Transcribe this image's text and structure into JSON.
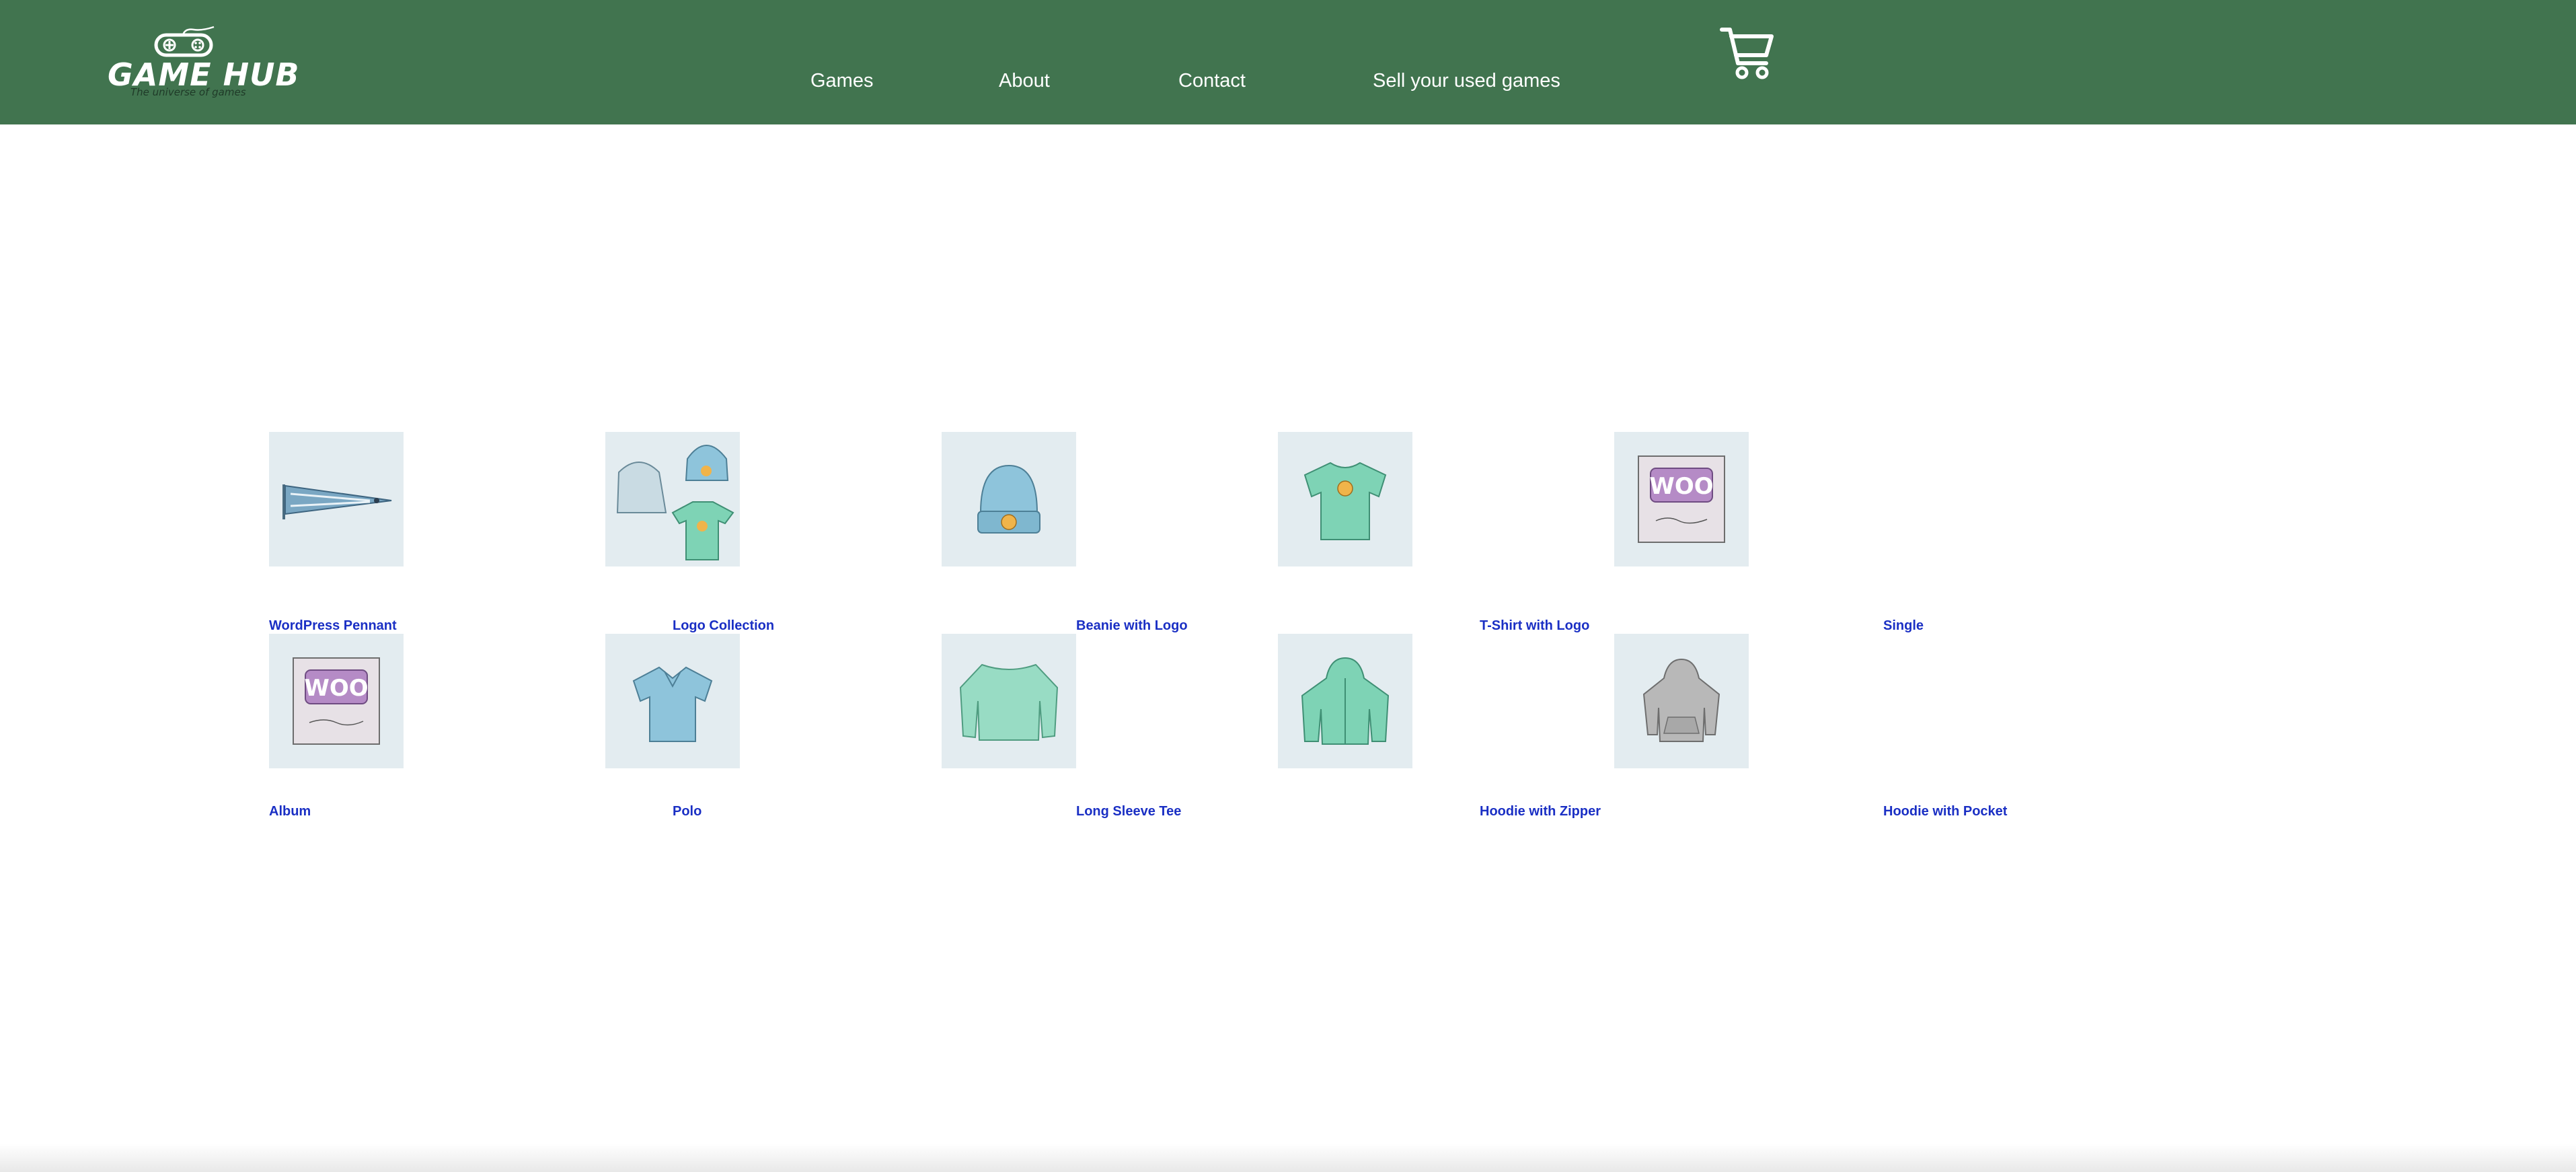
{
  "header": {
    "logo": {
      "title": "GAME HUB",
      "tagline": "The universe of games"
    },
    "nav": [
      {
        "label": "Games"
      },
      {
        "label": "About"
      },
      {
        "label": "Contact"
      },
      {
        "label": "Sell your used games"
      }
    ],
    "cart_icon": "shopping-cart-icon"
  },
  "colors": {
    "header_bg": "#41744f",
    "product_link": "#1a2fc4",
    "thumb_bg": "#e3ecf0"
  },
  "products": [
    {
      "title": "WordPress Pennant",
      "icon": "pennant-icon"
    },
    {
      "title": "Logo Collection",
      "icon": "logo-collection-icon"
    },
    {
      "title": "Beanie with Logo",
      "icon": "beanie-icon"
    },
    {
      "title": "T-Shirt with Logo",
      "icon": "tshirt-icon"
    },
    {
      "title": "Single",
      "icon": "woo-single-icon"
    },
    {
      "title": "Album",
      "icon": "woo-album-icon"
    },
    {
      "title": "Polo",
      "icon": "polo-icon"
    },
    {
      "title": "Long Sleeve Tee",
      "icon": "long-sleeve-tee-icon"
    },
    {
      "title": "Hoodie with Zipper",
      "icon": "hoodie-zipper-icon"
    },
    {
      "title": "Hoodie with Pocket",
      "icon": "hoodie-pocket-icon"
    }
  ]
}
